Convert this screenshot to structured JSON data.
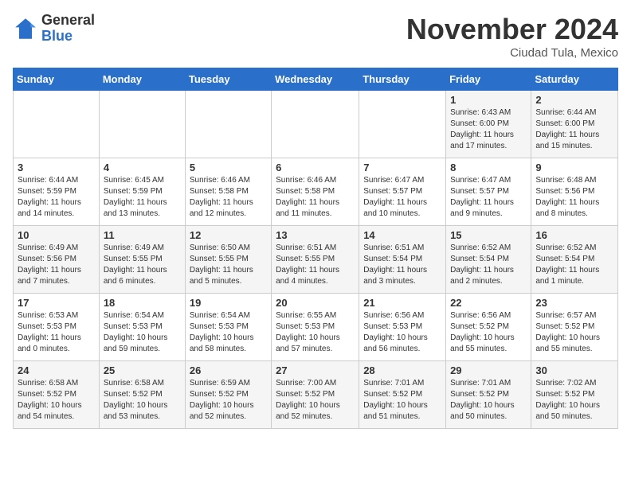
{
  "header": {
    "logo_general": "General",
    "logo_blue": "Blue",
    "month_title": "November 2024",
    "subtitle": "Ciudad Tula, Mexico"
  },
  "weekdays": [
    "Sunday",
    "Monday",
    "Tuesday",
    "Wednesday",
    "Thursday",
    "Friday",
    "Saturday"
  ],
  "weeks": [
    [
      {
        "day": "",
        "info": ""
      },
      {
        "day": "",
        "info": ""
      },
      {
        "day": "",
        "info": ""
      },
      {
        "day": "",
        "info": ""
      },
      {
        "day": "",
        "info": ""
      },
      {
        "day": "1",
        "info": "Sunrise: 6:43 AM\nSunset: 6:00 PM\nDaylight: 11 hours and 17 minutes."
      },
      {
        "day": "2",
        "info": "Sunrise: 6:44 AM\nSunset: 6:00 PM\nDaylight: 11 hours and 15 minutes."
      }
    ],
    [
      {
        "day": "3",
        "info": "Sunrise: 6:44 AM\nSunset: 5:59 PM\nDaylight: 11 hours and 14 minutes."
      },
      {
        "day": "4",
        "info": "Sunrise: 6:45 AM\nSunset: 5:59 PM\nDaylight: 11 hours and 13 minutes."
      },
      {
        "day": "5",
        "info": "Sunrise: 6:46 AM\nSunset: 5:58 PM\nDaylight: 11 hours and 12 minutes."
      },
      {
        "day": "6",
        "info": "Sunrise: 6:46 AM\nSunset: 5:58 PM\nDaylight: 11 hours and 11 minutes."
      },
      {
        "day": "7",
        "info": "Sunrise: 6:47 AM\nSunset: 5:57 PM\nDaylight: 11 hours and 10 minutes."
      },
      {
        "day": "8",
        "info": "Sunrise: 6:47 AM\nSunset: 5:57 PM\nDaylight: 11 hours and 9 minutes."
      },
      {
        "day": "9",
        "info": "Sunrise: 6:48 AM\nSunset: 5:56 PM\nDaylight: 11 hours and 8 minutes."
      }
    ],
    [
      {
        "day": "10",
        "info": "Sunrise: 6:49 AM\nSunset: 5:56 PM\nDaylight: 11 hours and 7 minutes."
      },
      {
        "day": "11",
        "info": "Sunrise: 6:49 AM\nSunset: 5:55 PM\nDaylight: 11 hours and 6 minutes."
      },
      {
        "day": "12",
        "info": "Sunrise: 6:50 AM\nSunset: 5:55 PM\nDaylight: 11 hours and 5 minutes."
      },
      {
        "day": "13",
        "info": "Sunrise: 6:51 AM\nSunset: 5:55 PM\nDaylight: 11 hours and 4 minutes."
      },
      {
        "day": "14",
        "info": "Sunrise: 6:51 AM\nSunset: 5:54 PM\nDaylight: 11 hours and 3 minutes."
      },
      {
        "day": "15",
        "info": "Sunrise: 6:52 AM\nSunset: 5:54 PM\nDaylight: 11 hours and 2 minutes."
      },
      {
        "day": "16",
        "info": "Sunrise: 6:52 AM\nSunset: 5:54 PM\nDaylight: 11 hours and 1 minute."
      }
    ],
    [
      {
        "day": "17",
        "info": "Sunrise: 6:53 AM\nSunset: 5:53 PM\nDaylight: 11 hours and 0 minutes."
      },
      {
        "day": "18",
        "info": "Sunrise: 6:54 AM\nSunset: 5:53 PM\nDaylight: 10 hours and 59 minutes."
      },
      {
        "day": "19",
        "info": "Sunrise: 6:54 AM\nSunset: 5:53 PM\nDaylight: 10 hours and 58 minutes."
      },
      {
        "day": "20",
        "info": "Sunrise: 6:55 AM\nSunset: 5:53 PM\nDaylight: 10 hours and 57 minutes."
      },
      {
        "day": "21",
        "info": "Sunrise: 6:56 AM\nSunset: 5:53 PM\nDaylight: 10 hours and 56 minutes."
      },
      {
        "day": "22",
        "info": "Sunrise: 6:56 AM\nSunset: 5:52 PM\nDaylight: 10 hours and 55 minutes."
      },
      {
        "day": "23",
        "info": "Sunrise: 6:57 AM\nSunset: 5:52 PM\nDaylight: 10 hours and 55 minutes."
      }
    ],
    [
      {
        "day": "24",
        "info": "Sunrise: 6:58 AM\nSunset: 5:52 PM\nDaylight: 10 hours and 54 minutes."
      },
      {
        "day": "25",
        "info": "Sunrise: 6:58 AM\nSunset: 5:52 PM\nDaylight: 10 hours and 53 minutes."
      },
      {
        "day": "26",
        "info": "Sunrise: 6:59 AM\nSunset: 5:52 PM\nDaylight: 10 hours and 52 minutes."
      },
      {
        "day": "27",
        "info": "Sunrise: 7:00 AM\nSunset: 5:52 PM\nDaylight: 10 hours and 52 minutes."
      },
      {
        "day": "28",
        "info": "Sunrise: 7:01 AM\nSunset: 5:52 PM\nDaylight: 10 hours and 51 minutes."
      },
      {
        "day": "29",
        "info": "Sunrise: 7:01 AM\nSunset: 5:52 PM\nDaylight: 10 hours and 50 minutes."
      },
      {
        "day": "30",
        "info": "Sunrise: 7:02 AM\nSunset: 5:52 PM\nDaylight: 10 hours and 50 minutes."
      }
    ]
  ]
}
